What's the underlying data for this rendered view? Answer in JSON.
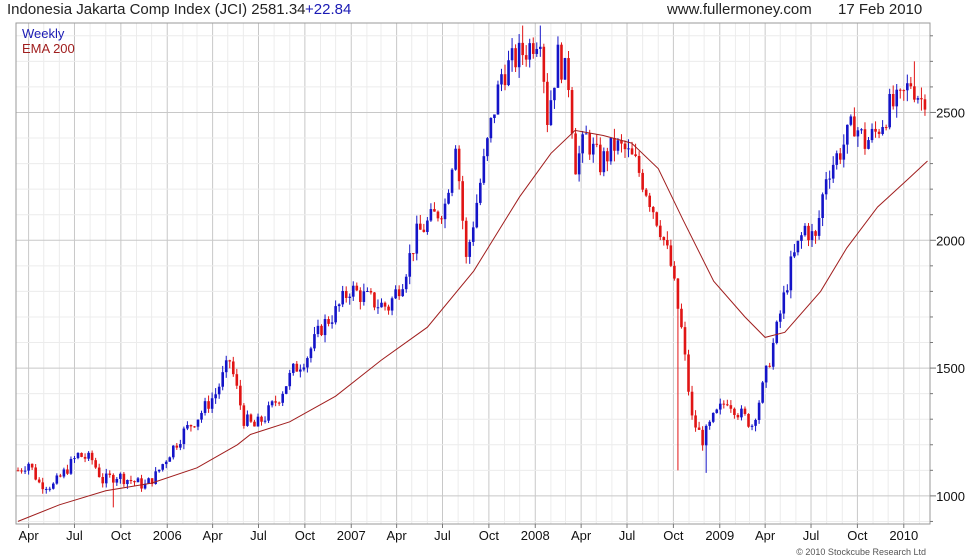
{
  "header": {
    "title": "Indonesia Jakarta Comp Index (JCI) 2581.34",
    "change": "+22.84",
    "site": "www.fullermoney.com",
    "date": "17 Feb 2010"
  },
  "footer": {
    "copyright": "© 2010 Stockcube Research Ltd"
  },
  "colors": {
    "up": "#1414c8",
    "down": "#e01414",
    "ema": "#a01e1e",
    "grid": "#d8d8d8"
  },
  "chart_data": {
    "type": "line",
    "title": "Indonesia Jakarta Comp Index (JCI) 2581.34 +22.84",
    "legend": [
      "Weekly",
      "EMA 200"
    ],
    "legend_position": "top-left",
    "grid": true,
    "xlabel": "",
    "ylabel": "",
    "ylim": [
      890,
      2850
    ],
    "x_range": [
      "2005-03-07",
      "2010-02-22"
    ],
    "x_ticks": [
      {
        "label": "Apr",
        "date": "2005-04-01"
      },
      {
        "label": "Jul",
        "date": "2005-07-01"
      },
      {
        "label": "Oct",
        "date": "2005-10-01"
      },
      {
        "label": "2006",
        "date": "2006-01-01"
      },
      {
        "label": "Apr",
        "date": "2006-04-01"
      },
      {
        "label": "Jul",
        "date": "2006-07-01"
      },
      {
        "label": "Oct",
        "date": "2006-10-01"
      },
      {
        "label": "2007",
        "date": "2007-01-01"
      },
      {
        "label": "Apr",
        "date": "2007-04-01"
      },
      {
        "label": "Jul",
        "date": "2007-07-01"
      },
      {
        "label": "Oct",
        "date": "2007-10-01"
      },
      {
        "label": "2008",
        "date": "2008-01-01"
      },
      {
        "label": "Apr",
        "date": "2008-04-01"
      },
      {
        "label": "Jul",
        "date": "2008-07-01"
      },
      {
        "label": "Oct",
        "date": "2008-10-01"
      },
      {
        "label": "2009",
        "date": "2009-01-01"
      },
      {
        "label": "Apr",
        "date": "2009-04-01"
      },
      {
        "label": "Jul",
        "date": "2009-07-01"
      },
      {
        "label": "Oct",
        "date": "2009-10-01"
      },
      {
        "label": "2010",
        "date": "2010-01-01"
      }
    ],
    "y_ticks": [
      1000,
      1500,
      2000,
      2500
    ],
    "series": [
      {
        "name": "Weekly",
        "style": "candlestick",
        "anchors": [
          [
            "2005-03-11",
            1100
          ],
          [
            "2005-04-01",
            1130
          ],
          [
            "2005-04-22",
            1050
          ],
          [
            "2005-05-20",
            1040
          ],
          [
            "2005-06-10",
            1090
          ],
          [
            "2005-07-08",
            1160
          ],
          [
            "2005-08-05",
            1140
          ],
          [
            "2005-08-26",
            1060
          ],
          [
            "2005-09-23",
            1080
          ],
          [
            "2005-10-21",
            1060
          ],
          [
            "2005-11-18",
            1040
          ],
          [
            "2005-12-09",
            1080
          ],
          [
            "2006-01-06",
            1170
          ],
          [
            "2006-02-03",
            1250
          ],
          [
            "2006-03-03",
            1310
          ],
          [
            "2006-04-07",
            1400
          ],
          [
            "2006-05-05",
            1530
          ],
          [
            "2006-06-02",
            1300
          ],
          [
            "2006-06-23",
            1270
          ],
          [
            "2006-07-14",
            1310
          ],
          [
            "2006-08-11",
            1390
          ],
          [
            "2006-09-08",
            1490
          ],
          [
            "2006-10-06",
            1550
          ],
          [
            "2006-11-03",
            1660
          ],
          [
            "2006-12-01",
            1720
          ],
          [
            "2006-12-29",
            1810
          ],
          [
            "2007-01-26",
            1780
          ],
          [
            "2007-02-23",
            1750
          ],
          [
            "2007-03-16",
            1740
          ],
          [
            "2007-04-13",
            1850
          ],
          [
            "2007-05-11",
            2020
          ],
          [
            "2007-06-08",
            2080
          ],
          [
            "2007-07-06",
            2140
          ],
          [
            "2007-07-27",
            2400
          ],
          [
            "2007-08-17",
            1920
          ],
          [
            "2007-09-07",
            2150
          ],
          [
            "2007-10-05",
            2450
          ],
          [
            "2007-10-26",
            2650
          ],
          [
            "2007-11-23",
            2710
          ],
          [
            "2007-12-21",
            2760
          ],
          [
            "2008-01-11",
            2820
          ],
          [
            "2008-01-25",
            2480
          ],
          [
            "2008-02-15",
            2720
          ],
          [
            "2008-03-07",
            2620
          ],
          [
            "2008-03-21",
            2300
          ],
          [
            "2008-04-11",
            2400
          ],
          [
            "2008-05-09",
            2300
          ],
          [
            "2008-06-06",
            2370
          ],
          [
            "2008-06-27",
            2350
          ],
          [
            "2008-07-18",
            2300
          ],
          [
            "2008-08-08",
            2200
          ],
          [
            "2008-09-05",
            2050
          ],
          [
            "2008-09-26",
            1900
          ],
          [
            "2008-10-17",
            1650
          ],
          [
            "2008-11-07",
            1300
          ],
          [
            "2008-11-28",
            1220
          ],
          [
            "2008-12-19",
            1300
          ],
          [
            "2009-01-16",
            1380
          ],
          [
            "2009-02-06",
            1330
          ],
          [
            "2009-03-06",
            1280
          ],
          [
            "2009-03-27",
            1420
          ],
          [
            "2009-04-24",
            1650
          ],
          [
            "2009-05-22",
            1900
          ],
          [
            "2009-06-19",
            2050
          ],
          [
            "2009-07-10",
            2000
          ],
          [
            "2009-07-31",
            2260
          ],
          [
            "2009-08-28",
            2350
          ],
          [
            "2009-09-25",
            2460
          ],
          [
            "2009-10-16",
            2380
          ],
          [
            "2009-11-06",
            2420
          ],
          [
            "2009-12-04",
            2520
          ],
          [
            "2009-12-25",
            2540
          ],
          [
            "2010-01-15",
            2620
          ],
          [
            "2010-02-05",
            2550
          ],
          [
            "2010-02-17",
            2581
          ]
        ]
      },
      {
        "name": "EMA 200",
        "style": "line",
        "points": [
          [
            "2005-03-11",
            900
          ],
          [
            "2005-06-01",
            965
          ],
          [
            "2005-09-01",
            1020
          ],
          [
            "2005-12-01",
            1050
          ],
          [
            "2006-03-01",
            1110
          ],
          [
            "2006-05-20",
            1200
          ],
          [
            "2006-06-15",
            1240
          ],
          [
            "2006-09-01",
            1290
          ],
          [
            "2006-12-01",
            1390
          ],
          [
            "2007-03-01",
            1530
          ],
          [
            "2007-06-01",
            1660
          ],
          [
            "2007-09-01",
            1880
          ],
          [
            "2007-12-01",
            2170
          ],
          [
            "2008-02-01",
            2340
          ],
          [
            "2008-03-20",
            2430
          ],
          [
            "2008-05-15",
            2410
          ],
          [
            "2008-07-10",
            2380
          ],
          [
            "2008-09-01",
            2280
          ],
          [
            "2008-10-20",
            2080
          ],
          [
            "2008-12-20",
            1840
          ],
          [
            "2009-02-20",
            1700
          ],
          [
            "2009-04-01",
            1620
          ],
          [
            "2009-05-10",
            1640
          ],
          [
            "2009-07-20",
            1800
          ],
          [
            "2009-09-10",
            1970
          ],
          [
            "2009-11-10",
            2130
          ],
          [
            "2010-01-10",
            2240
          ],
          [
            "2010-02-17",
            2310
          ]
        ]
      }
    ],
    "notable_lows": [
      [
        "2005-09-16",
        955
      ],
      [
        "2008-10-10",
        1100
      ],
      [
        "2008-12-05",
        1090
      ]
    ],
    "notable_highs": [
      [
        "2007-12-07",
        2840
      ],
      [
        "2008-01-11",
        2840
      ],
      [
        "2010-01-22",
        2700
      ]
    ]
  }
}
